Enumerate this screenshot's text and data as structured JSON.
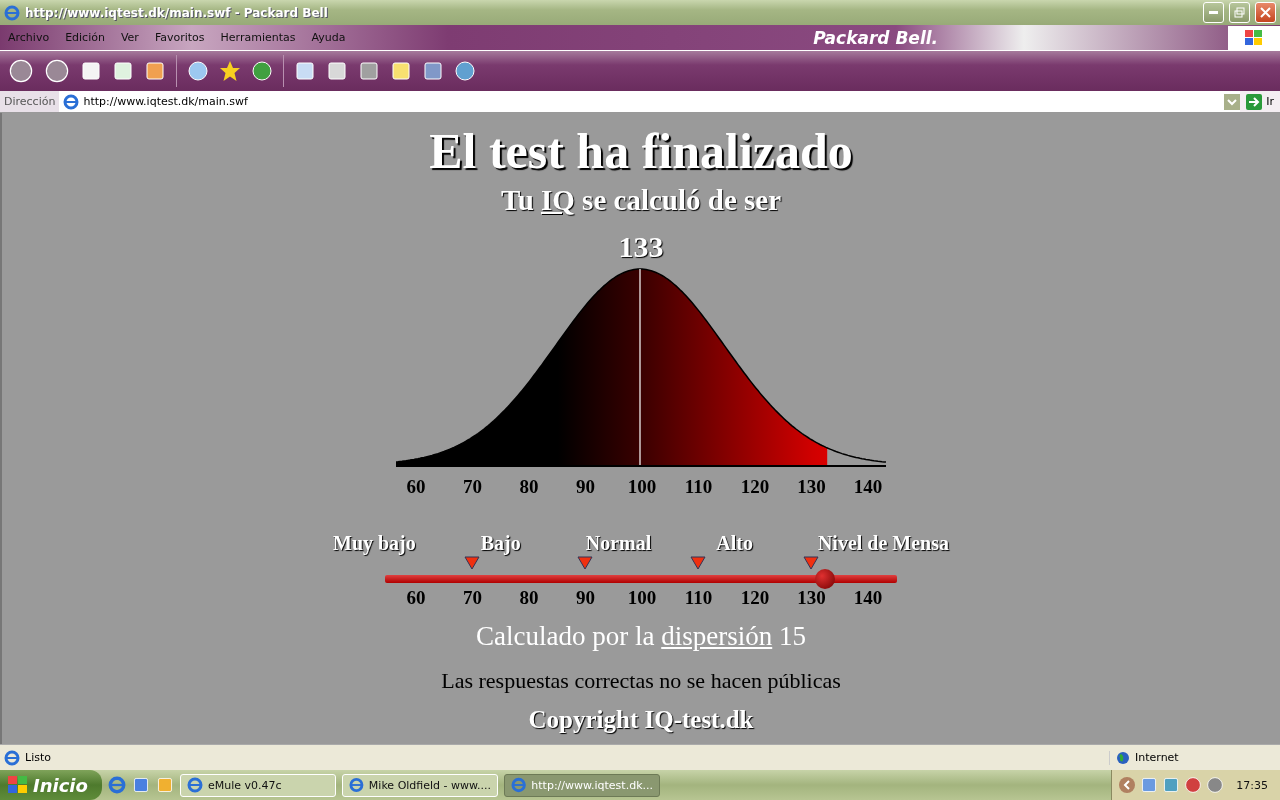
{
  "window": {
    "title": "http://www.iqtest.dk/main.swf - Packard Bell"
  },
  "menu": [
    "Archivo",
    "Edición",
    "Ver",
    "Favoritos",
    "Herramientas",
    "Ayuda"
  ],
  "brand": "Packard Bell.",
  "address": {
    "label": "Dirección",
    "value": "http://www.iqtest.dk/main.swf",
    "go": "Ir"
  },
  "page": {
    "title": "El test ha finalizado",
    "subtitle": {
      "before": "Tu",
      "link": "IQ",
      "after": "se calculó de ser"
    },
    "score": "133",
    "curve": {
      "level": 0.88,
      "ticks": [
        "60",
        "70",
        "80",
        "90",
        "100",
        "110",
        "120",
        "130",
        "140"
      ]
    },
    "categories": [
      "Muy bajo",
      "Bajo",
      "Normal",
      "Alto",
      "Nivel de Mensa"
    ],
    "slider": {
      "level": 0.86,
      "ticks": [
        "60",
        "70",
        "80",
        "90",
        "100",
        "110",
        "120",
        "130",
        "140"
      ]
    },
    "dispersion": {
      "before": "Calculado por la",
      "link": "dispersión",
      "after": "15"
    },
    "note": "Las respuestas correctas no se hacen públicas",
    "copyright": "Copyright IQ-test.dk"
  },
  "status_bar": {
    "text": "Listo",
    "zone": "Internet"
  },
  "taskbar": {
    "start": "Inicio",
    "tasks": [
      {
        "label": "eMule v0.47c",
        "selected": false
      },
      {
        "label": "Mike Oldfield - www....",
        "selected": false
      },
      {
        "label": "http://www.iqtest.dk...",
        "selected": true
      }
    ],
    "clock": "17:35"
  }
}
